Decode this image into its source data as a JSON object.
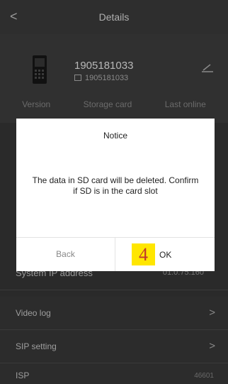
{
  "header": {
    "title": "Details",
    "back_glyph": "<"
  },
  "device": {
    "name": "1905181033",
    "id": "1905181033",
    "icon": "phone-icon",
    "stats": [
      "Version",
      "Storage card",
      "Last online"
    ]
  },
  "system_ip": {
    "label": "System IP address",
    "value": "01.0.75.160"
  },
  "list": [
    {
      "label": "Video log",
      "chevron": ">"
    },
    {
      "label": "SIP setting",
      "chevron": ">"
    },
    {
      "label": "ISP",
      "value": "46601"
    }
  ],
  "dialog": {
    "title": "Notice",
    "message": "The data in SD card will be deleted. Confirm if SD is in the card slot",
    "back_label": "Back",
    "ok_label": "OK",
    "marker": "4"
  },
  "colors": {
    "overlay": "#2a2a2a",
    "dialog_bg": "#ffffff",
    "marker_bg": "#ffe600",
    "marker_text": "#c0392b"
  }
}
